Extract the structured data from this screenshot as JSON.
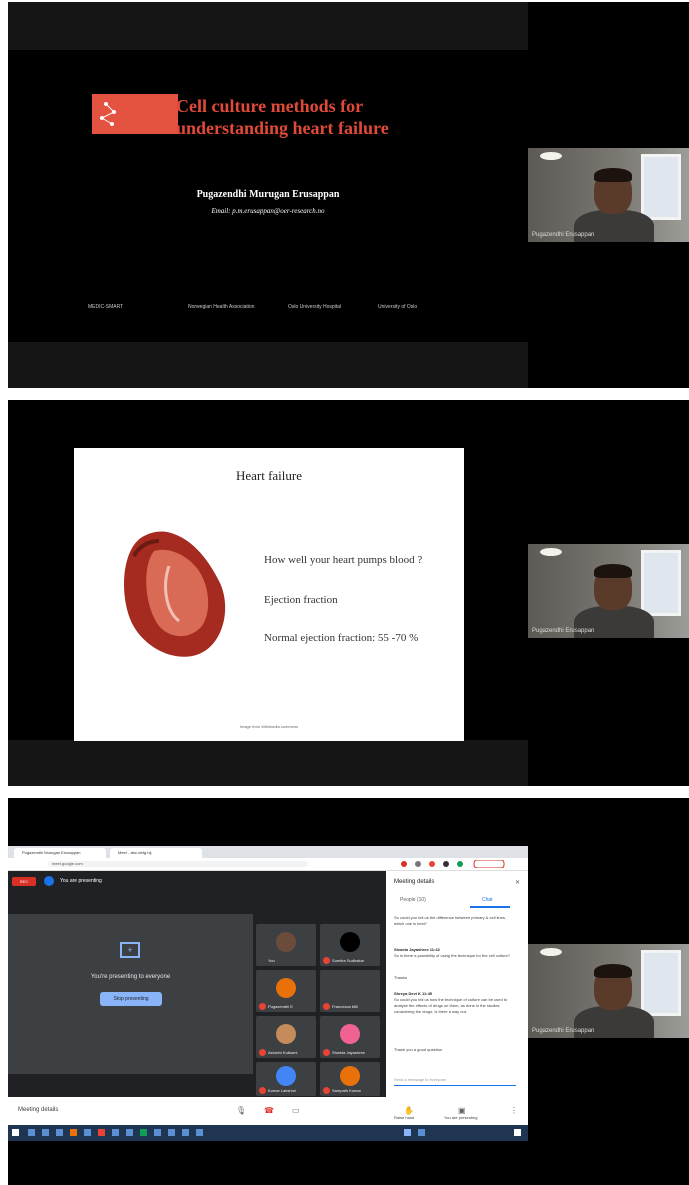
{
  "panel1": {
    "slide_title_line1": "Cell culture methods for",
    "slide_title_line2": "understanding heart failure",
    "author": "Pugazendhi Murugan Erusappan",
    "email": "Email: p.m.erusappan@oer-research.no",
    "logo_texts": [
      "MEDIC-SMART",
      "Norwegian Health Association",
      "Oslo University Hospital",
      "University of Oslo"
    ],
    "presenter_name": "Pugazendhi Erusappan"
  },
  "panel2": {
    "slide_title": "Heart failure",
    "bullets": [
      "How well your heart pumps blood ?",
      "Ejection fraction",
      "Normal ejection fraction: 55 -70 %"
    ],
    "credit": "Image from Wikimedia commons",
    "presenter_name": "Pugazendhi Erusappan"
  },
  "panel3": {
    "browser_tabs": [
      "Pugazendhi Murugan Erusappan",
      "Meet - abc-defg-hij"
    ],
    "url": "meet.google.com",
    "rec_label": "REC",
    "presenting_banner": "You are presenting",
    "presenting_message": "You're presenting to everyone",
    "stop_button": "Stop presenting",
    "participants": [
      {
        "name": "You",
        "color": "#6b4b3a"
      },
      {
        "name": "Sumitra Sudhakar",
        "color": "#000000"
      },
      {
        "name": "Pugazendhi E",
        "color": "#e8710a"
      },
      {
        "name": "Francesca Mill",
        "color": "#3c4043"
      },
      {
        "name": "Ashwini Kulkarni",
        "color": "#c58b5b"
      },
      {
        "name": "Shweta Jayashree",
        "color": "#f06292"
      },
      {
        "name": "Kumar Lakshmi",
        "color": "#4285f4"
      },
      {
        "name": "Sampath Kumar",
        "color": "#e8710a"
      }
    ],
    "side_panel": {
      "title": "Meeting details",
      "tab_people": "People (10)",
      "tab_chat": "Chat",
      "messages": [
        {
          "sender": "",
          "text": "So could you tell us the difference between primary & cell lines, which one is best?"
        },
        {
          "sender": "Shweta Jayashree 11:42",
          "text": "So is there a possibility of using the technique for the cell culture?"
        },
        {
          "sender": "",
          "text": "Thanks"
        },
        {
          "sender": "Shreya Devi K 11:45",
          "text": "So could you tell us how the technique of culture can be used to analyse the effects of drugs on them, as done in the studies considering the drugs, is there a way out."
        },
        {
          "sender": "",
          "text": "Thank you a good question"
        }
      ],
      "send_placeholder": "Send a message to everyone"
    },
    "controls": {
      "meeting_details": "Meeting details",
      "raise_hand": "Raise hand",
      "presenting": "You are presenting"
    },
    "presenter_name": "Pugazendhi Erusappan"
  }
}
